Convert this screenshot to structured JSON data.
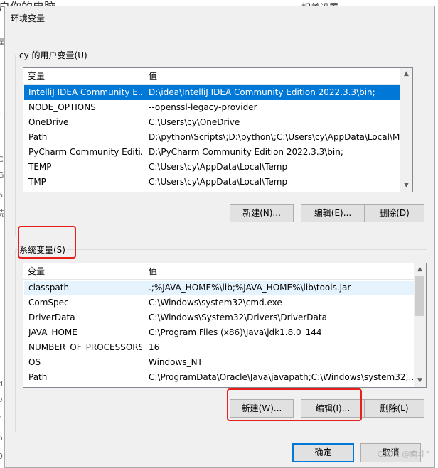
{
  "background": {
    "top_left_text": "户你的电脑",
    "top_right_text": "相关设置",
    "left_edge_chars": [
      "量",
      "(",
      "C",
      "G",
      "6",
      "克",
      "3",
      "6",
      "克",
      "d",
      "2",
      "/",
      "5",
      "0",
      "1"
    ]
  },
  "dialog": {
    "title": "环境变量",
    "user_vars": {
      "label": "cy 的用户变量(U)",
      "columns": [
        "变量",
        "值"
      ],
      "rows": [
        {
          "name": "IntelliJ IDEA Community E...",
          "value": "D:\\idea\\IntelliJ IDEA Community Edition 2022.3.3\\bin;"
        },
        {
          "name": "NODE_OPTIONS",
          "value": "--openssl-legacy-provider"
        },
        {
          "name": "OneDrive",
          "value": "C:\\Users\\cy\\OneDrive"
        },
        {
          "name": "Path",
          "value": "D:\\python\\Scripts\\;D:\\python\\;C:\\Users\\cy\\AppData\\Local\\Mic..."
        },
        {
          "name": "PyCharm Community Editi...",
          "value": "D:\\PyCharm Community Edition 2022.3.3\\bin;"
        },
        {
          "name": "TEMP",
          "value": "C:\\Users\\cy\\AppData\\Local\\Temp"
        },
        {
          "name": "TMP",
          "value": "C:\\Users\\cy\\AppData\\Local\\Temp"
        }
      ],
      "selected_index": 0,
      "buttons": {
        "new": "新建(N)...",
        "edit": "编辑(E)...",
        "delete": "删除(D)"
      }
    },
    "system_vars": {
      "label": "系统变量(S)",
      "columns": [
        "变量",
        "值"
      ],
      "rows": [
        {
          "name": "classpath",
          "value": ".;%JAVA_HOME%\\lib;%JAVA_HOME%\\lib\\tools.jar"
        },
        {
          "name": "ComSpec",
          "value": "C:\\Windows\\system32\\cmd.exe"
        },
        {
          "name": "DriverData",
          "value": "C:\\Windows\\System32\\Drivers\\DriverData"
        },
        {
          "name": "JAVA_HOME",
          "value": "C:\\Program Files (x86)\\Java\\jdk1.8.0_144"
        },
        {
          "name": "NUMBER_OF_PROCESSORS",
          "value": "16"
        },
        {
          "name": "OS",
          "value": "Windows_NT"
        },
        {
          "name": "Path",
          "value": "C:\\ProgramData\\Oracle\\Java\\javapath;C:\\Windows\\system32;..."
        }
      ],
      "hover_index": 0,
      "buttons": {
        "new": "新建(W)...",
        "edit": "编辑(I)...",
        "delete": "删除(L)"
      }
    },
    "footer": {
      "ok": "确定",
      "cancel": "取消"
    }
  },
  "watermark": "CSDN @南斗°",
  "colors": {
    "selection": "#0078d7",
    "annotation": "#e8201c"
  }
}
